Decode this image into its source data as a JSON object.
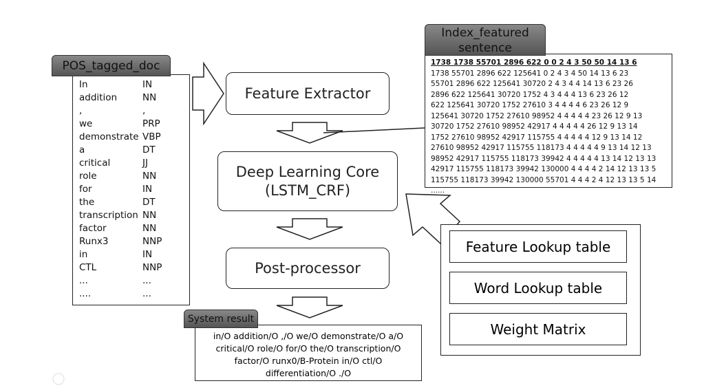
{
  "pos_doc": {
    "label": "POS_tagged_doc",
    "rows": [
      [
        "In",
        "IN"
      ],
      [
        "addition",
        "NN"
      ],
      [
        ",",
        ","
      ],
      [
        "we",
        "PRP"
      ],
      [
        "demonstrate",
        "VBP"
      ],
      [
        "a",
        "DT"
      ],
      [
        "critical",
        "JJ"
      ],
      [
        "role",
        "NN"
      ],
      [
        "for",
        "IN"
      ],
      [
        "the",
        "DT"
      ],
      [
        "transcription",
        "NN"
      ],
      [
        "factor",
        "NN"
      ],
      [
        "Runx3",
        "NNP"
      ],
      [
        "in",
        "IN"
      ],
      [
        "CTL",
        "NNP"
      ],
      [
        "...",
        "..."
      ],
      [
        "....",
        "..."
      ]
    ]
  },
  "pipeline": {
    "feature_extractor": "Feature Extractor",
    "core_line1": "Deep Learning Core",
    "core_line2": "(LSTM_CRF)",
    "post_processor": "Post-processor"
  },
  "index_sentence": {
    "label": "Index_featured sentence",
    "header": "1738 1738 55701 2896 622 0 0 2 4 3 50 50 14 13 6",
    "lines": [
      "1738 55701 2896 622 125641 0 2 4 3 4 50 14 13 6 23",
      "55701 2896 622 125641 30720 2 4 3 4 4 14 13 6 23 26",
      "2896 622 125641 30720 1752 4 3 4 4 4 13 6 23 26 12",
      "622 125641 30720 1752 27610 3 4 4 4 4 6 23 26 12 9",
      "125641 30720 1752 27610 98952 4 4 4 4 4 23 26 12 9 13",
      "30720 1752 27610 98952 42917 4 4 4 4 4 26 12 9 13 14",
      "1752 27610 98952 42917 115755 4 4 4 4 4 12 9 13 14 12",
      "27610 98952 42917 115755 118173 4 4 4 4 4 9 13 14 12 13",
      "98952 42917 115755 118173 39942 4 4 4 4 4 13 14 12 13 13",
      "42917 115755 118173 39942 130000 4 4 4 4 2 14 12 13 13 5",
      "115755 118173 39942 130000 55701 4 4 4 2 4 12 13 13 5 14",
      "......"
    ]
  },
  "lookups": [
    "Feature Lookup table",
    "Word Lookup table",
    "Weight Matrix"
  ],
  "system_result": {
    "label": "System result",
    "text": "in/O addition/O ,/O we/O demonstrate/O a/O critical/O role/O for/O the/O transcription/O factor/O runx0/B-Protein in/O ctl/O differentiation/O ./O"
  }
}
